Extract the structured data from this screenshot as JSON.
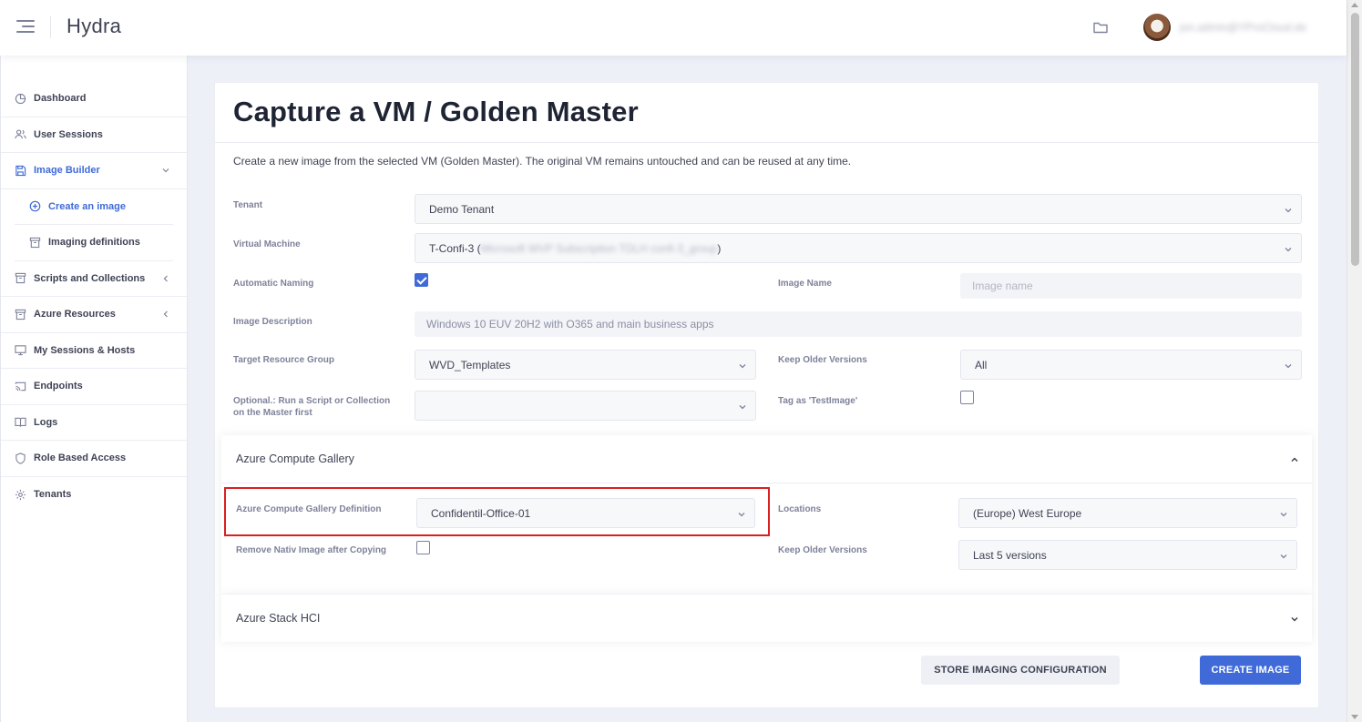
{
  "app": {
    "brand": "Hydra",
    "username": "jon.admin@YProCloud.de"
  },
  "sidebar": {
    "items": [
      {
        "label": "Dashboard",
        "icon": "pie-chart-icon"
      },
      {
        "label": "User Sessions",
        "icon": "users-icon"
      },
      {
        "label": "Image Builder",
        "icon": "save-icon",
        "active": true
      },
      {
        "label": "Create an image",
        "icon": "plus-circle-icon",
        "sub": true,
        "active": true
      },
      {
        "label": "Imaging definitions",
        "icon": "archive-icon",
        "sub": true
      },
      {
        "label": "Scripts and Collections",
        "icon": "archive-icon"
      },
      {
        "label": "Azure Resources",
        "icon": "archive-icon"
      },
      {
        "label": "My Sessions & Hosts",
        "icon": "monitor-icon"
      },
      {
        "label": "Endpoints",
        "icon": "cast-icon"
      },
      {
        "label": "Logs",
        "icon": "book-icon"
      },
      {
        "label": "Role Based Access",
        "icon": "shield-icon"
      },
      {
        "label": "Tenants",
        "icon": "gear-icon"
      }
    ]
  },
  "page": {
    "title": "Capture a VM / Golden Master",
    "description": "Create a new image from the selected VM (Golden Master). The original VM remains untouched and can be reused at any time."
  },
  "form": {
    "tenant_label": "Tenant",
    "tenant_value": "Demo Tenant",
    "vm_label": "Virtual Machine",
    "vm_value": "T-Confi-3 (",
    "vm_blurred": "Microsoft WVP Subscription TDLH confi-3_group",
    "vm_value_end": ")",
    "auto_naming_label": "Automatic Naming",
    "image_name_label": "Image Name",
    "image_name_placeholder": "Image name",
    "image_desc_label": "Image Description",
    "image_desc_value": "Windows 10 EUV 20H2 with O365 and main business apps",
    "target_rg_label": "Target Resource Group",
    "target_rg_value": "WVD_Templates",
    "keep_older_label": "Keep Older Versions",
    "keep_older_value": "All",
    "optional_label": "Optional.: Run a Script or Collection on the Master first",
    "optional_value": "",
    "tag_label": "Tag as 'TestImage'"
  },
  "gallery": {
    "title": "Azure Compute Gallery",
    "definition_label": "Azure Compute Gallery Definition",
    "definition_value": "Confidentil-Office-01",
    "locations_label": "Locations",
    "locations_value": "(Europe) West Europe",
    "remove_label": "Remove Nativ Image after Copying",
    "keep_label": "Keep Older Versions",
    "keep_value": "Last 5 versions"
  },
  "hci": {
    "title": "Azure Stack HCI"
  },
  "buttons": {
    "store": "STORE IMAGING CONFIGURATION",
    "create": "CREATE IMAGE"
  },
  "colors": {
    "accent": "#3f6ad8",
    "highlight": "#d92020"
  }
}
